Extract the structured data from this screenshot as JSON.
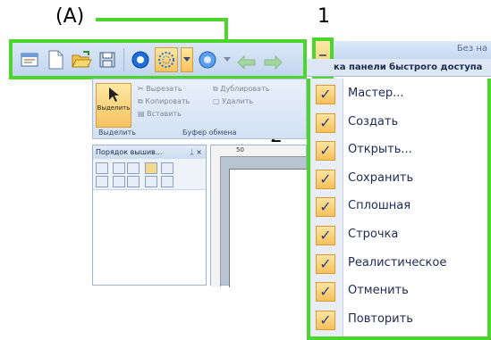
{
  "callouts": {
    "a": "(A)",
    "one": "1",
    "two": "2"
  },
  "window": {
    "title_partial": "Без на",
    "menu_title": "ка панели быстрого доступа"
  },
  "ribbon": {
    "select_label": "Выделить",
    "cut": "Вырезать",
    "copy": "Копировать",
    "paste": "Вставить",
    "duplicate": "Дублировать",
    "delete": "Удалить",
    "group_select": "Выделить",
    "group_clipboard": "Буфер обмена"
  },
  "panel": {
    "title": "Порядок вышив...",
    "pin": "ᛣ ×"
  },
  "ruler": {
    "mark": "50"
  },
  "menu": {
    "items": [
      {
        "label": "Мастер...",
        "checked": true
      },
      {
        "label": "Создать",
        "checked": true
      },
      {
        "label": "Открыть...",
        "checked": true
      },
      {
        "label": "Сохранить",
        "checked": true
      },
      {
        "label": "Сплошная",
        "checked": true
      },
      {
        "label": "Строчка",
        "checked": true
      },
      {
        "label": "Реалистическое",
        "checked": true
      },
      {
        "label": "Отменить",
        "checked": true
      },
      {
        "label": "Повторить",
        "checked": true
      }
    ],
    "check_glyph": "✓"
  },
  "colors": {
    "highlight_green": "#4cd62b",
    "toolbar_blue": "#c2d6ef",
    "check_gold": "#f6c05a"
  },
  "toolbar_icons": [
    "wizard-icon",
    "new-file-icon",
    "open-folder-icon",
    "save-icon",
    "solid-view-icon",
    "stitch-view-icon",
    "dropdown-arrow-icon",
    "realistic-view-icon",
    "undo-icon",
    "redo-icon"
  ]
}
